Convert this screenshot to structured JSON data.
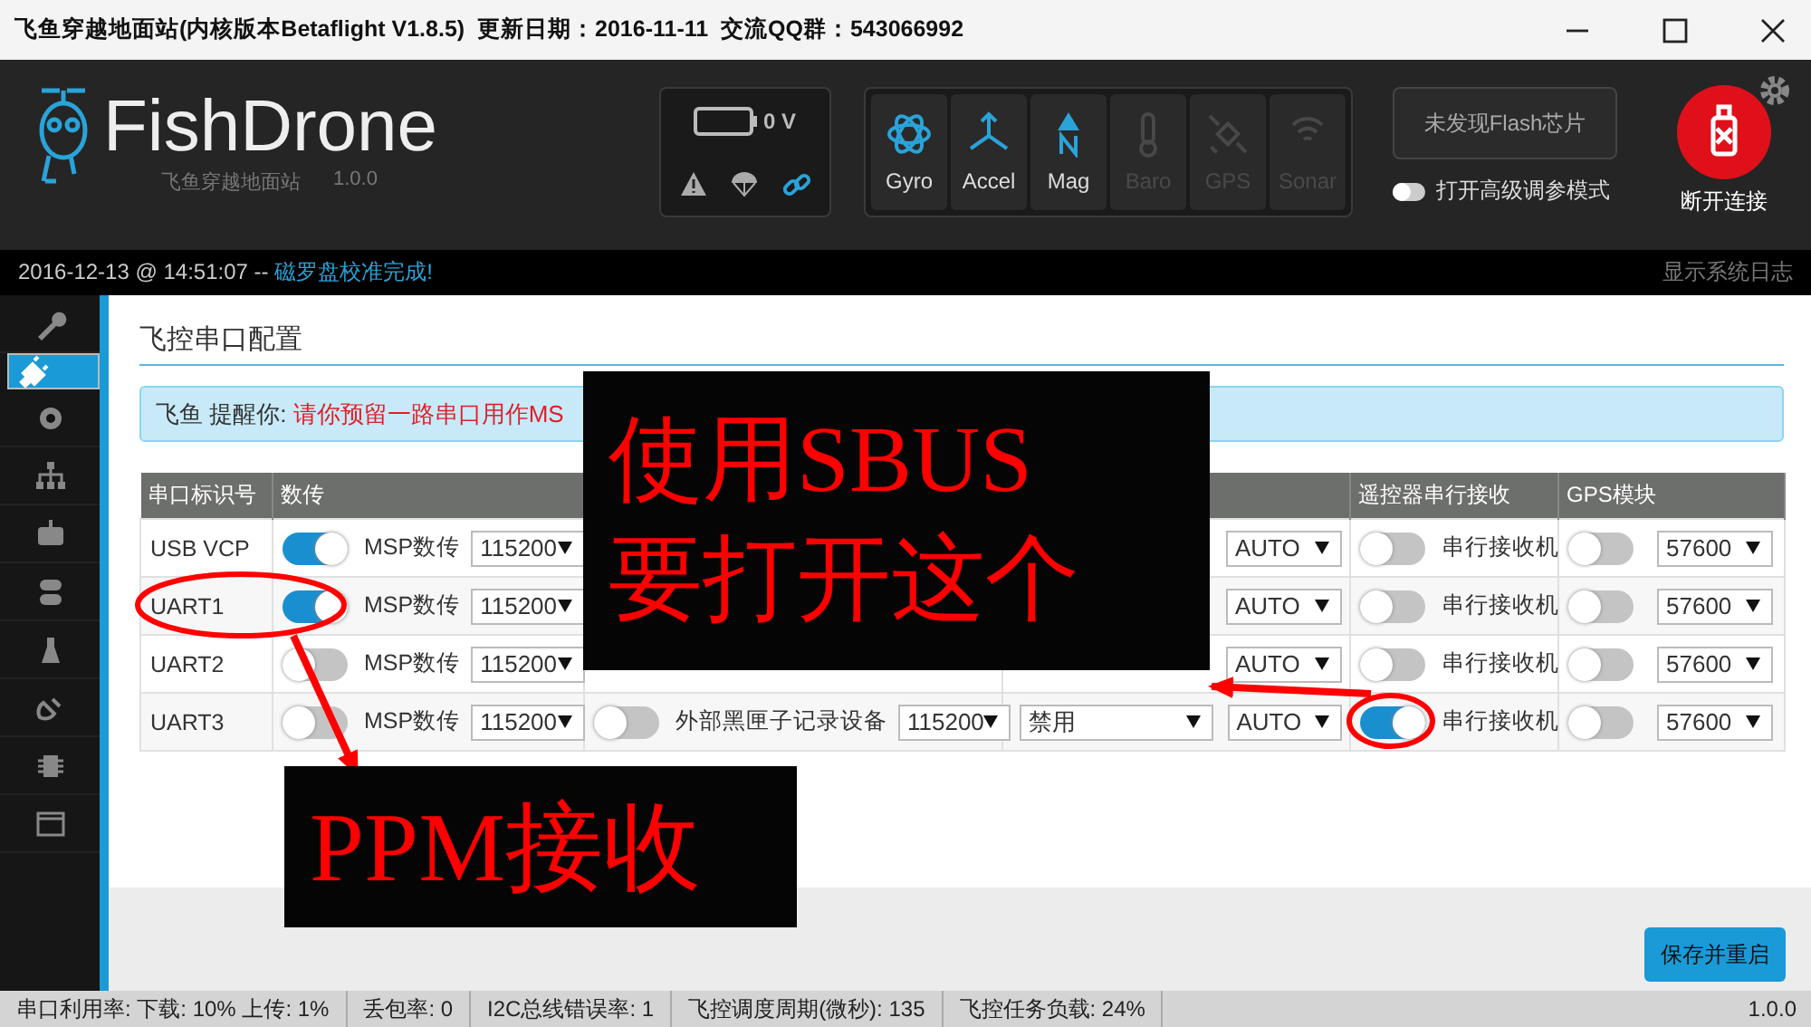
{
  "window": {
    "title": "飞鱼穿越地面站(内核版本Betaflight V1.8.5)  更新日期：2016-11-11  交流QQ群：543066992"
  },
  "header": {
    "brand": "FishDrone",
    "subtitle": "飞鱼穿越地面站",
    "version": "1.0.0",
    "battery": "0 V",
    "sensors": [
      {
        "label": "Gyro",
        "active": true
      },
      {
        "label": "Accel",
        "active": true
      },
      {
        "label": "Mag",
        "active": true
      },
      {
        "label": "Baro",
        "active": false
      },
      {
        "label": "GPS",
        "active": false
      },
      {
        "label": "Sonar",
        "active": false
      }
    ],
    "flash_button": "未发现Flash芯片",
    "expert_mode": {
      "label": "打开高级调参模式",
      "on": false
    },
    "disconnect": "断开连接"
  },
  "log_line": {
    "time": "2016-12-13 @ 14:51:07 -- ",
    "message": "磁罗盘校准完成!",
    "show_log": "显示系统日志"
  },
  "sidebar": {
    "items": [
      {
        "selected": false
      },
      {
        "selected": true
      },
      {
        "selected": false
      },
      {
        "selected": false
      },
      {
        "selected": false
      },
      {
        "selected": false
      },
      {
        "selected": false
      },
      {
        "selected": false
      },
      {
        "selected": false
      },
      {
        "selected": false
      }
    ]
  },
  "page": {
    "title": "飞控串口配置",
    "notice_prefix": "飞鱼 提醒你: ",
    "notice": "请你预留一路串口用作MS"
  },
  "table": {
    "columns": {
      "port": "串口标识号",
      "telemetry": "数传",
      "serial_rx": "遥控器串行接收",
      "gps": "GPS模块"
    },
    "rows": [
      {
        "port": "USB VCP",
        "msp_on": true,
        "msp_label": "MSP数传",
        "msp_baud": "115200",
        "telemetry_baud": "AUTO",
        "rx_on": false,
        "rx_label": "串行接收机",
        "gps_on": false,
        "gps_baud": "57600"
      },
      {
        "port": "UART1",
        "msp_on": true,
        "msp_label": "MSP数传",
        "msp_baud": "115200",
        "telemetry_baud": "AUTO",
        "rx_on": false,
        "rx_label": "串行接收机",
        "gps_on": false,
        "gps_baud": "57600"
      },
      {
        "port": "UART2",
        "msp_on": false,
        "msp_label": "MSP数传",
        "msp_baud": "115200",
        "telemetry_baud": "AUTO",
        "rx_on": false,
        "rx_label": "串行接收机",
        "gps_on": false,
        "gps_baud": "57600"
      },
      {
        "port": "UART3",
        "msp_on": false,
        "msp_label": "MSP数传",
        "msp_baud": "115200",
        "blackbox": {
          "on": false,
          "label": "外部黑匣子记录设备",
          "baud": "115200"
        },
        "telemetry": "禁用",
        "telemetry_baud": "AUTO",
        "rx_on": true,
        "rx_label": "串行接收机",
        "gps_on": false,
        "gps_baud": "57600"
      }
    ]
  },
  "save_button": "保存并重启",
  "callouts": [
    {
      "lines": [
        "使用SBUS",
        "要打开这个"
      ]
    },
    {
      "lines": [
        "PPM接收"
      ]
    }
  ],
  "status_bar": [
    "串口利用率: 下载: 10% 上传: 1%",
    "丢包率: 0",
    "I2C总线错误率: 1",
    "飞控调度周期(微秒): 135",
    "飞控任务负载: 24%"
  ],
  "app_version": "1.0.0"
}
